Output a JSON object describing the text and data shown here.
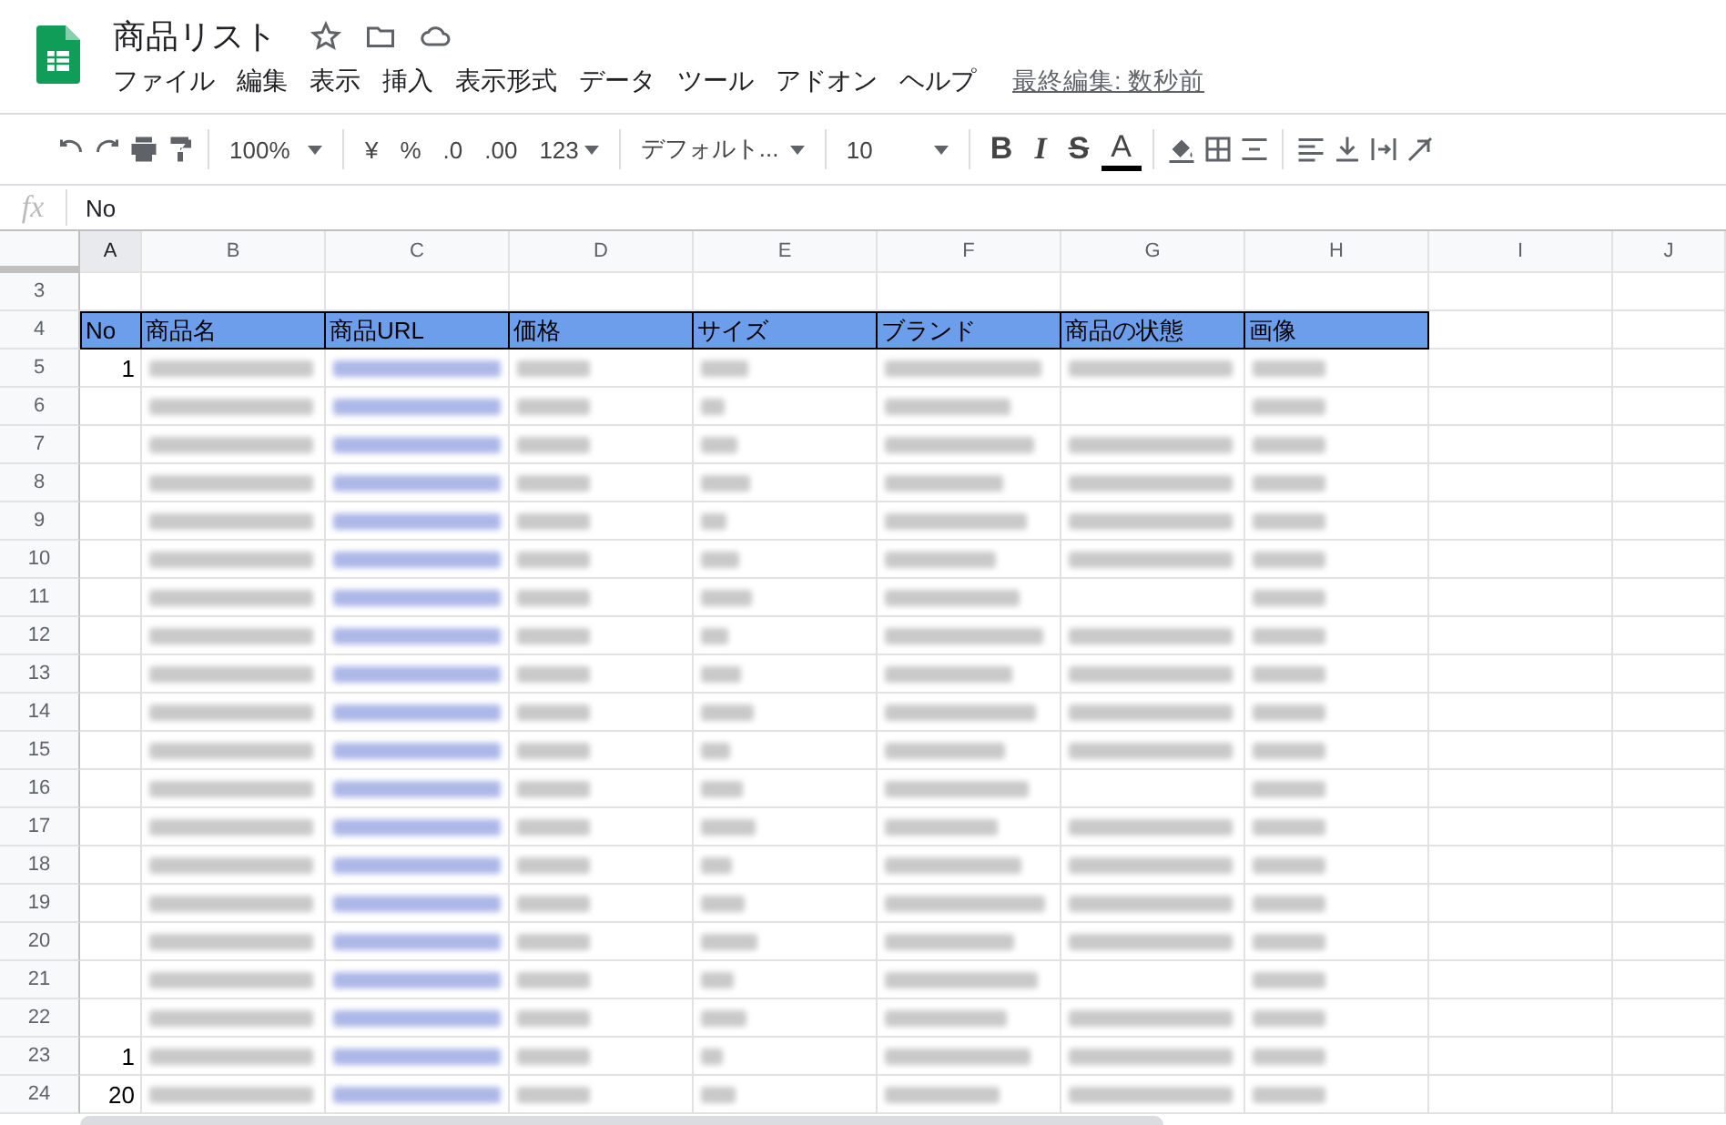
{
  "document": {
    "title": "商品リスト",
    "last_edit": "最終編集: 数秒前"
  },
  "menu": [
    "ファイル",
    "編集",
    "表示",
    "挿入",
    "表示形式",
    "データ",
    "ツール",
    "アドオン",
    "ヘルプ"
  ],
  "toolbar": {
    "zoom": "100%",
    "currency": "¥",
    "percent": "%",
    "decrease_decimal": ".0",
    "increase_decimal": ".00",
    "more_formats": "123",
    "font": "デフォルト...",
    "font_size": "10",
    "bold": "B",
    "italic": "I",
    "strikethrough": "S",
    "text_color": "A"
  },
  "formula_bar": {
    "label": "fx",
    "value": "No"
  },
  "sheet": {
    "columns": [
      "A",
      "B",
      "C",
      "D",
      "E",
      "F",
      "G",
      "H",
      "I",
      "J"
    ],
    "rows": [
      {
        "number": "3",
        "cells": []
      },
      {
        "number": "4",
        "kind": "header",
        "cells": [
          "No",
          "商品名",
          "商品URL",
          "価格",
          "サイズ",
          "ブランド",
          "商品の状態",
          "画像"
        ]
      },
      {
        "number": "5",
        "cells": [
          "1"
        ]
      },
      {
        "number": "6",
        "cells": []
      },
      {
        "number": "7",
        "cells": []
      },
      {
        "number": "8",
        "cells": []
      },
      {
        "number": "9",
        "cells": []
      },
      {
        "number": "10",
        "cells": []
      },
      {
        "number": "11",
        "cells": []
      },
      {
        "number": "12",
        "cells": []
      },
      {
        "number": "13",
        "cells": []
      },
      {
        "number": "14",
        "cells": []
      },
      {
        "number": "15",
        "cells": []
      },
      {
        "number": "16",
        "cells": []
      },
      {
        "number": "17",
        "cells": []
      },
      {
        "number": "18",
        "cells": []
      },
      {
        "number": "19",
        "cells": []
      },
      {
        "number": "20",
        "cells": []
      },
      {
        "number": "21",
        "cells": []
      },
      {
        "number": "22",
        "cells": []
      },
      {
        "number": "23",
        "cells": [
          "1"
        ]
      },
      {
        "number": "24",
        "cells": [
          "20"
        ]
      }
    ]
  }
}
